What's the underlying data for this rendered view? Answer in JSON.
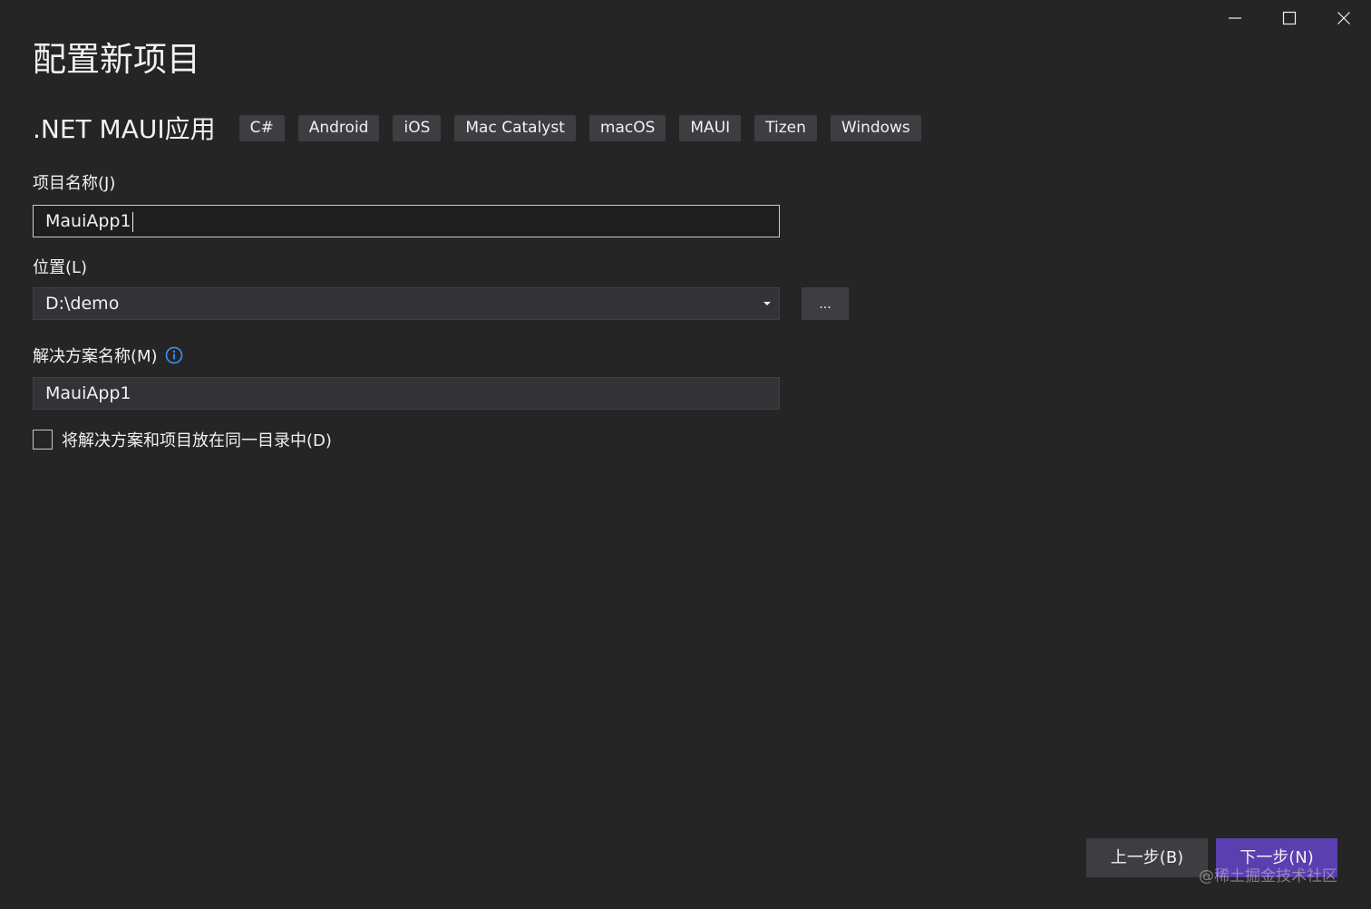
{
  "window": {
    "controls": {
      "minimize_icon": "minimize-icon",
      "maximize_icon": "maximize-icon",
      "close_icon": "close-icon"
    }
  },
  "page": {
    "title": "配置新项目"
  },
  "template": {
    "name": ".NET MAUI应用",
    "tags": [
      "C#",
      "Android",
      "iOS",
      "Mac Catalyst",
      "macOS",
      "MAUI",
      "Tizen",
      "Windows"
    ]
  },
  "form": {
    "project_name": {
      "label": "项目名称(J)",
      "value": "MauiApp1"
    },
    "location": {
      "label": "位置(L)",
      "value": "D:\\demo",
      "browse_label": "..."
    },
    "solution_name": {
      "label": "解决方案名称(M)",
      "value": "MauiApp1",
      "info_icon": "info-icon"
    },
    "same_directory": {
      "label": "将解决方案和项目放在同一目录中(D)",
      "checked": false
    }
  },
  "footer": {
    "back_label": "上一步(B)",
    "next_label": "下一步(N)",
    "watermark": "@稀土掘金技术社区"
  },
  "colors": {
    "background": "#252526",
    "accent": "#5a3fb0",
    "info": "#3794ff"
  }
}
